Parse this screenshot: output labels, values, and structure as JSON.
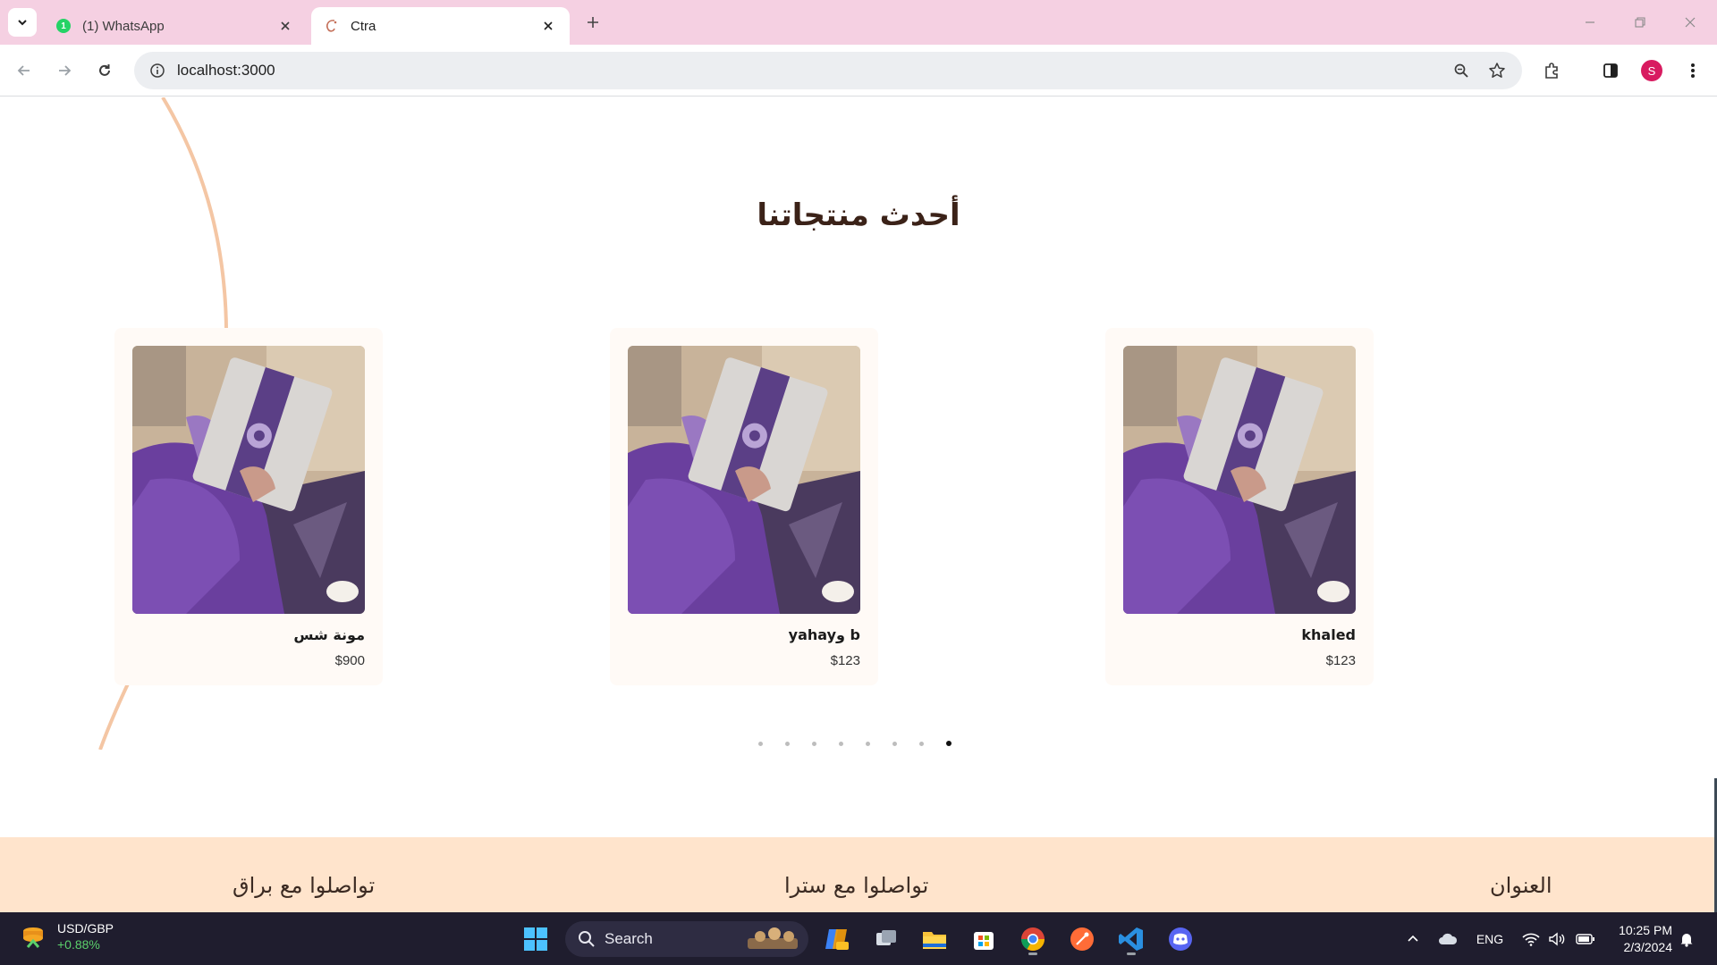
{
  "browser": {
    "tabs": [
      {
        "title": "(1) WhatsApp",
        "favicon": "whatsapp-icon",
        "badge": "1",
        "active": false
      },
      {
        "title": "Ctra",
        "favicon": "ctra-logo-icon",
        "active": true
      }
    ],
    "url": "localhost:3000",
    "profile_initial": "S"
  },
  "page": {
    "section_title": "أحدث منتجاتنا",
    "products": [
      {
        "name": "مونة شس",
        "price": "$900"
      },
      {
        "name": "b وyahay",
        "price": "$123"
      },
      {
        "name": "khaled",
        "price": "$123"
      }
    ],
    "carousel": {
      "total": 8,
      "active_index": 7
    },
    "footer": {
      "col_left": "تواصلوا مع براق",
      "col_center": "تواصلوا مع سترا",
      "col_right": "العنوان"
    },
    "colors": {
      "accent_curve": "#f4c6a4",
      "footer_bg": "#ffe4cc",
      "title_color": "#3b2218",
      "tab_strip": "#f5d0e2"
    }
  },
  "taskbar": {
    "widget_title": "USD/GBP",
    "widget_value": "+0.88%",
    "search_label": "Search",
    "language": "ENG",
    "time": "10:25 PM",
    "date": "2/3/2024"
  }
}
